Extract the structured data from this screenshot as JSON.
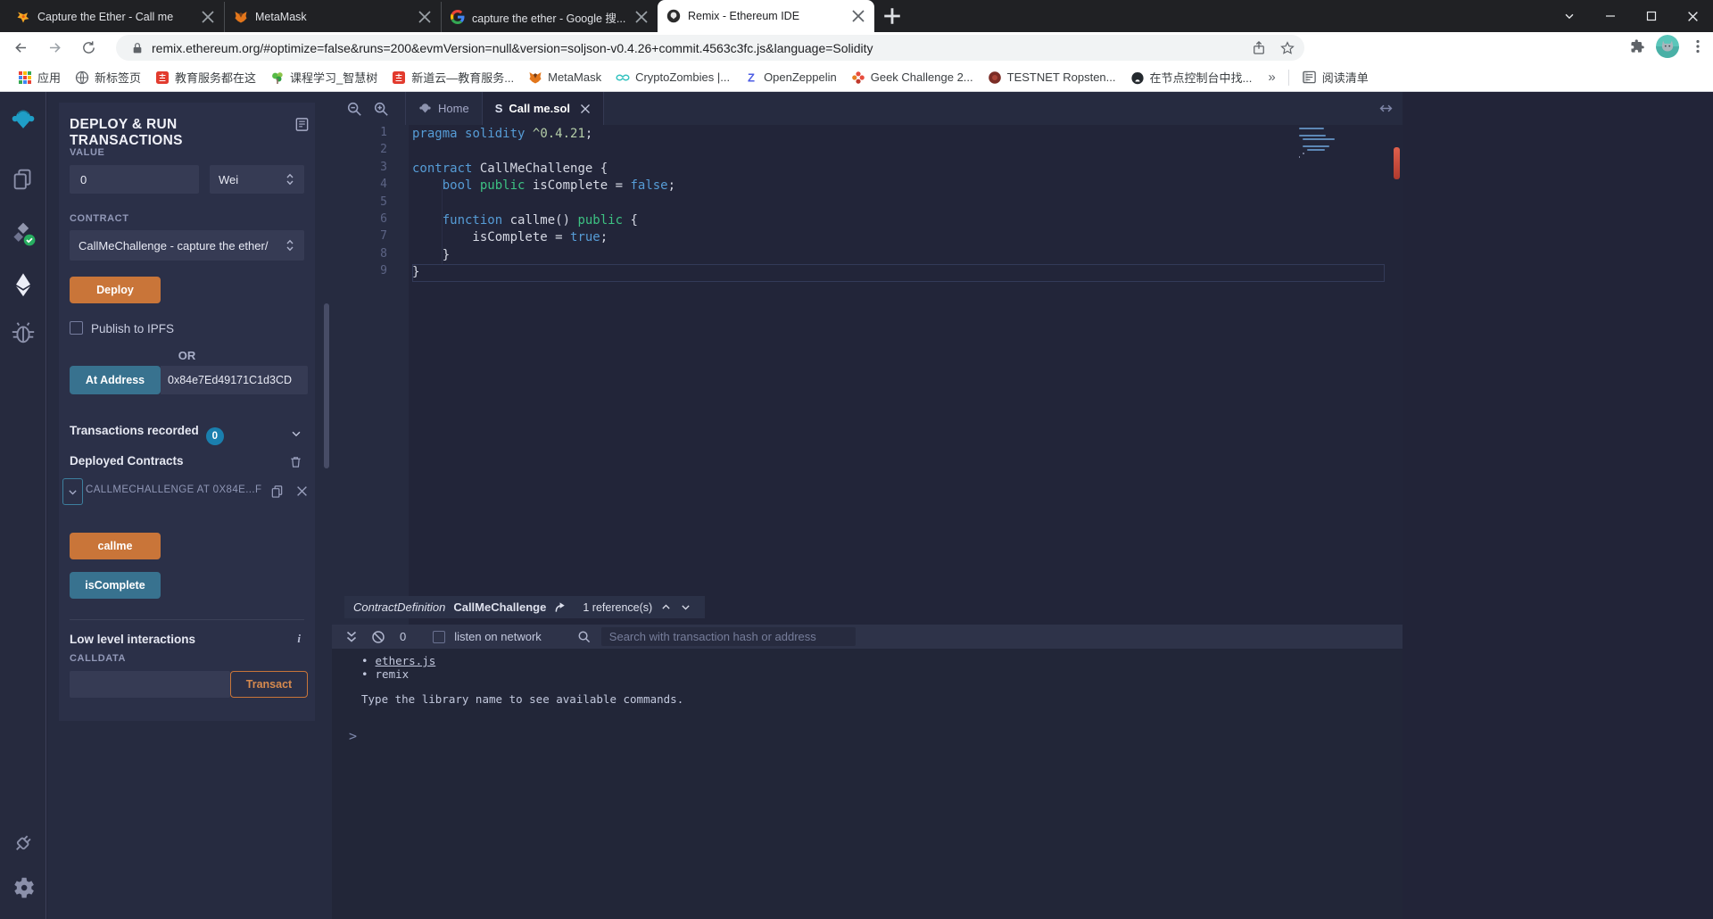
{
  "browser": {
    "tabs": [
      {
        "title": "Capture the Ether - Call me",
        "icon": "flame",
        "active": false
      },
      {
        "title": "MetaMask",
        "icon": "fox",
        "active": false
      },
      {
        "title": "capture the ether - Google 搜...",
        "icon": "google",
        "active": false
      },
      {
        "title": "Remix - Ethereum IDE",
        "icon": "remix-fav",
        "active": true
      }
    ],
    "url": "remix.ethereum.org/#optimize=false&runs=200&evmVersion=null&version=soljson-v0.4.26+commit.4563c3fc.js&language=Solidity",
    "bookmarks": [
      {
        "label": "应用",
        "icon": "apps-grid"
      },
      {
        "label": "新标签页",
        "icon": "globe"
      },
      {
        "label": "教育服务都在这",
        "icon": "redbox"
      },
      {
        "label": "课程学习_智慧树",
        "icon": "tree"
      },
      {
        "label": "新道云—教育服务...",
        "icon": "redbox"
      },
      {
        "label": "MetaMask",
        "icon": "fox"
      },
      {
        "label": "CryptoZombies |...",
        "icon": "zombies"
      },
      {
        "label": "OpenZeppelin",
        "icon": "zeppelin"
      },
      {
        "label": "Geek Challenge 2...",
        "icon": "geek"
      },
      {
        "label": "TESTNET Ropsten...",
        "icon": "ropsten"
      },
      {
        "label": "在节点控制台中找...",
        "icon": "github"
      }
    ],
    "overflow_glyph": "»",
    "reading_list": "阅读清单"
  },
  "remix": {
    "activity": [
      {
        "icon": "remix-logo",
        "name": "remix-home",
        "active": false
      },
      {
        "icon": "files",
        "name": "file-explorer",
        "active": false
      },
      {
        "icon": "solc",
        "name": "solidity-compiler",
        "active": false
      },
      {
        "icon": "ethereum",
        "name": "deploy-run",
        "active": true
      },
      {
        "icon": "bug",
        "name": "debugger",
        "active": false
      },
      {
        "icon": "plug",
        "name": "plugin-manager",
        "active": false,
        "bottom": true
      },
      {
        "icon": "gear",
        "name": "settings",
        "active": false,
        "bottom": true
      }
    ],
    "panel": {
      "title": "DEPLOY & RUN TRANSACTIONS",
      "value_label": "VALUE",
      "value": "0",
      "unit": "Wei",
      "contract_label": "CONTRACT",
      "contract": "CallMeChallenge - capture the ether/",
      "deploy_label": "Deploy",
      "publish_label": "Publish to IPFS",
      "or_label": "OR",
      "at_address_label": "At Address",
      "at_address_value": "0x84e7Ed49171C1d3CD",
      "tx_recorded_label": "Transactions recorded",
      "tx_count": "0",
      "deployed_label": "Deployed Contracts",
      "instance_label": "CALLMECHALLENGE AT 0X84E...F",
      "callme_label": "callme",
      "iscomplete_label": "isComplete",
      "low_level_label": "Low level interactions",
      "calldata_label": "CALLDATA",
      "transact_label": "Transact"
    },
    "editor": {
      "tabs": [
        {
          "label": "Home",
          "icon": "remix-logo-sm",
          "active": false,
          "closable": false
        },
        {
          "label": "Call me.sol",
          "icon": "solfile",
          "active": true,
          "closable": true
        }
      ],
      "code_lines": [
        {
          "n": "1",
          "tokens": [
            {
              "t": "pragma",
              "c": "kw"
            },
            {
              "t": " ",
              "c": "pl"
            },
            {
              "t": "solidity",
              "c": "kw"
            },
            {
              "t": " ",
              "c": "pl"
            },
            {
              "t": "^0.4.21",
              "c": "num"
            },
            {
              "t": ";",
              "c": "pl"
            }
          ]
        },
        {
          "n": "2",
          "tokens": []
        },
        {
          "n": "3",
          "tokens": [
            {
              "t": "contract",
              "c": "kw"
            },
            {
              "t": " CallMeChallenge {",
              "c": "pl"
            }
          ]
        },
        {
          "n": "4",
          "tokens": [
            {
              "t": "    ",
              "c": "pl"
            },
            {
              "t": "bool",
              "c": "kw"
            },
            {
              "t": " ",
              "c": "pl"
            },
            {
              "t": "public",
              "c": "grn"
            },
            {
              "t": " isComplete = ",
              "c": "pl"
            },
            {
              "t": "false",
              "c": "kw"
            },
            {
              "t": ";",
              "c": "pl"
            }
          ]
        },
        {
          "n": "5",
          "tokens": []
        },
        {
          "n": "6",
          "tokens": [
            {
              "t": "    ",
              "c": "pl"
            },
            {
              "t": "function",
              "c": "kw"
            },
            {
              "t": " callme() ",
              "c": "pl"
            },
            {
              "t": "public",
              "c": "grn"
            },
            {
              "t": " {",
              "c": "pl"
            }
          ]
        },
        {
          "n": "7",
          "tokens": [
            {
              "t": "        isComplete = ",
              "c": "pl"
            },
            {
              "t": "true",
              "c": "kw"
            },
            {
              "t": ";",
              "c": "pl"
            }
          ]
        },
        {
          "n": "8",
          "tokens": [
            {
              "t": "    }",
              "c": "pl"
            }
          ]
        },
        {
          "n": "9",
          "tokens": [
            {
              "t": "}",
              "c": "pl"
            }
          ],
          "current": true
        }
      ],
      "peek": {
        "kind": "ContractDefinition",
        "name": "CallMeChallenge",
        "refs": "1 reference(s)"
      }
    },
    "terminal": {
      "badge_count": "0",
      "listen_label": "listen on network",
      "search_placeholder": "Search with transaction hash or address",
      "list_items": [
        {
          "text": "ethers.js",
          "link": true
        },
        {
          "text": "remix",
          "link": false
        }
      ],
      "hint": "Type the library name to see available commands.",
      "prompt": ">"
    }
  }
}
